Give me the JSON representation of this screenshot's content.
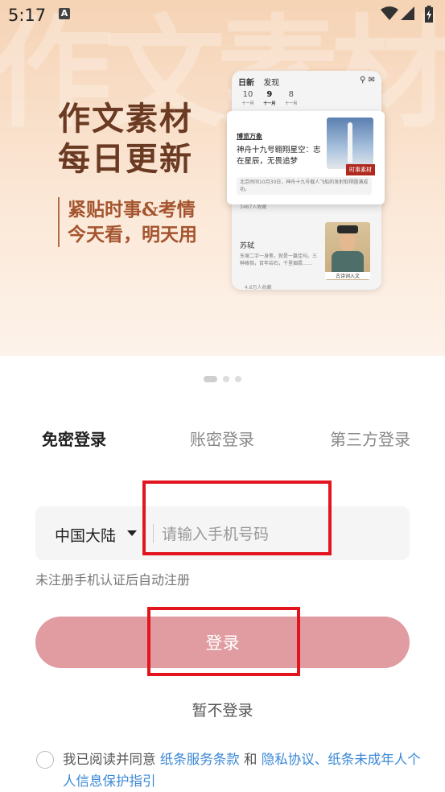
{
  "status_bar": {
    "time": "5:17",
    "notification_icon": "A"
  },
  "banner": {
    "background_text": "作文素材",
    "headline_line1": "作文素材",
    "headline_line2": "每日更新",
    "subline_line1": "紧贴时事&考情",
    "subline_line2": "今天看，明天用",
    "preview": {
      "tab_daily": "日新",
      "tab_discover": "发现",
      "dates": [
        {
          "day": "10",
          "month": "十一月"
        },
        {
          "day": "9",
          "month": "十一月"
        },
        {
          "day": "8",
          "month": "十一月"
        }
      ],
      "card1_tag": "博览万象",
      "card1_title": "神舟十九号翱翔星空：志在星辰，无畏追梦",
      "card1_badge": "时事素材",
      "card1_snippet": "北京时间10月30日，神舟十九号载人飞船的发射取得圆满成功。",
      "card1_count": "3467人收藏",
      "card2_name": "苏轼",
      "card2_snippet": "东坡二字一身笔，就是一篇佳句。三种格指，百年岩石，千里烟霞……",
      "card2_badge": "古诗词入文",
      "card2_count": "4.6万人收藏"
    }
  },
  "pager": {
    "count": 3,
    "active": 0
  },
  "tabs": [
    "免密登录",
    "账密登录",
    "第三方登录"
  ],
  "form": {
    "region": "中国大陆",
    "phone_placeholder": "请输入手机号码",
    "hint": "未注册手机认证后自动注册",
    "login_label": "登录",
    "skip_label": "暂不登录"
  },
  "agreement": {
    "prefix": "我已阅读并同意",
    "service_terms": "纸条服务条款",
    "and": "和",
    "privacy": "隐私协议、",
    "minor_policy": "纸条未成年人个人信息保护指引"
  },
  "colors": {
    "accent_link": "#3a88d6",
    "login_button": "#e09ca0",
    "highlight_box": "#e2141e",
    "headline": "#6b3a22",
    "subline": "#a4552f"
  }
}
